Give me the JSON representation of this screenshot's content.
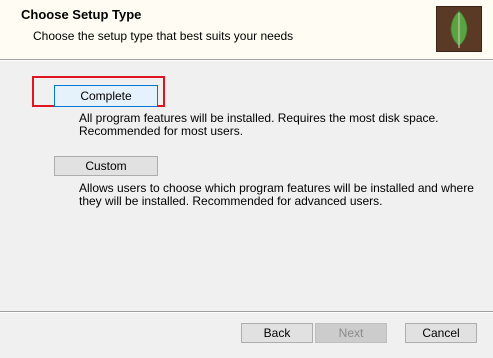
{
  "header": {
    "title": "Choose Setup Type",
    "subtitle": "Choose the setup type that best suits your needs",
    "logo_icon": "mongodb-leaf-icon"
  },
  "options": {
    "complete": {
      "button_label": "Complete",
      "description_line1": "All program features will be installed. Requires the most disk space.",
      "description_line2": "Recommended for most users.",
      "selected": true
    },
    "custom": {
      "button_label": "Custom",
      "description_line1": "Allows users to choose which program features will be installed and where",
      "description_line2": "they will be installed. Recommended for advanced users."
    }
  },
  "footer": {
    "back_label": "Back",
    "next_label": "Next",
    "next_enabled": false,
    "cancel_label": "Cancel"
  },
  "colors": {
    "header_bg": "#fffdf3",
    "body_bg": "#f0f0f0",
    "highlight_border": "#e0151f",
    "focus_border": "#0078d7",
    "logo_bg": "#5b3a25",
    "leaf_green": "#5aa344"
  }
}
